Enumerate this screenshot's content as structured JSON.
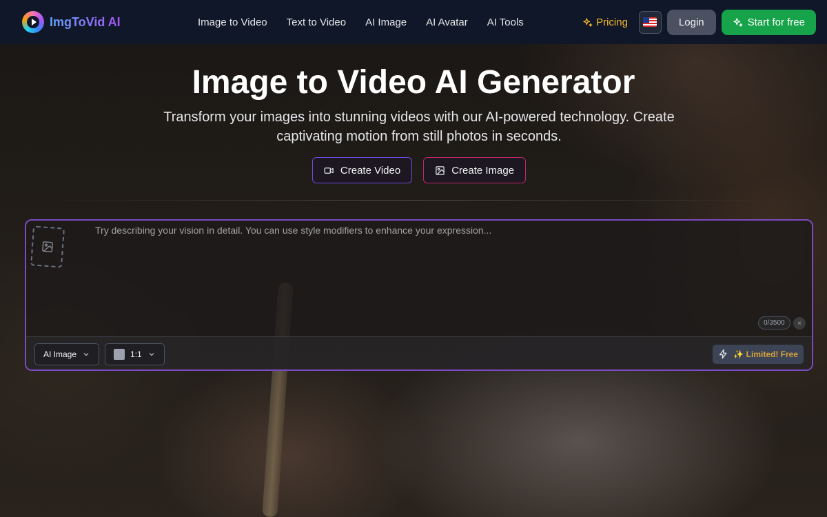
{
  "brand": {
    "name": "ImgToVid AI"
  },
  "nav": {
    "items": [
      {
        "label": "Image to Video"
      },
      {
        "label": "Text to Video"
      },
      {
        "label": "AI Image"
      },
      {
        "label": "AI Avatar"
      },
      {
        "label": "AI Tools"
      }
    ]
  },
  "header": {
    "pricing_label": "Pricing",
    "language_icon": "us-flag-icon",
    "login_label": "Login",
    "start_label": "Start for free"
  },
  "hero": {
    "title": "Image to Video AI Generator",
    "subtitle": "Transform your images into stunning videos with our AI-powered technology. Create captivating motion from still photos in seconds.",
    "create_video_label": "Create Video",
    "create_image_label": "Create Image"
  },
  "prompt": {
    "placeholder": "Try describing your vision in detail. You can use style modifiers to enhance your expression...",
    "value": "",
    "counter": "0/3500",
    "clear_label": "×"
  },
  "toolbar": {
    "model_selected": "AI Image",
    "ratio_selected": "1:1",
    "generate_badge": "✨ Limited! Free"
  },
  "colors": {
    "accent_green": "#16a34a",
    "pricing_gold": "#f5b92e",
    "panel_border": "#7c4bbf",
    "header_bg": "#101728"
  }
}
